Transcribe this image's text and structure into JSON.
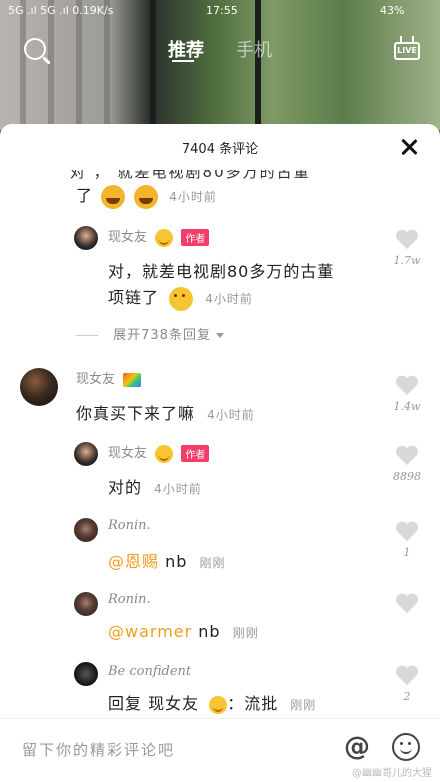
{
  "status_bar": {
    "left": "5G .ıl 5G .ıl 0.19K/s",
    "time": "17:55",
    "battery": "43%"
  },
  "top_nav": {
    "tab_recommend": "推荐",
    "tab_other": "手机"
  },
  "sheet": {
    "title": "7404 条评论",
    "partial_text": "对 ， 就差电视剧80多万的古董",
    "partial_time": "4小时前"
  },
  "comments": [
    {
      "user": "现女友",
      "author_badge": "作者",
      "text": "对，就差电视剧80多万的古董",
      "text2": "项链了",
      "time": "4小时前",
      "likes": "1.7w"
    },
    {
      "expand_label": "展开738条回复"
    },
    {
      "user": "现女友",
      "text": "你真买下来了嘛",
      "time": "4小时前",
      "likes": "1.4w"
    },
    {
      "user": "现女友",
      "author_badge": "作者",
      "text": "对的",
      "time": "4小时前",
      "likes": "8898"
    },
    {
      "user": "Ronin.",
      "mention": "@恩赐",
      "text": " nb",
      "time": "刚刚",
      "likes": "1"
    },
    {
      "user": "Ronin.",
      "mention": "@warmer",
      "text": " nb",
      "time": "刚刚",
      "likes": ""
    },
    {
      "user": "Be confident",
      "text": "回复 现女友",
      "text_after": "：流批",
      "time": "刚刚",
      "likes": "2"
    }
  ],
  "input_bar": {
    "placeholder": "留下你的精彩评论吧",
    "at_symbol": "@"
  },
  "watermark": "@幽幽哥儿的大猩"
}
